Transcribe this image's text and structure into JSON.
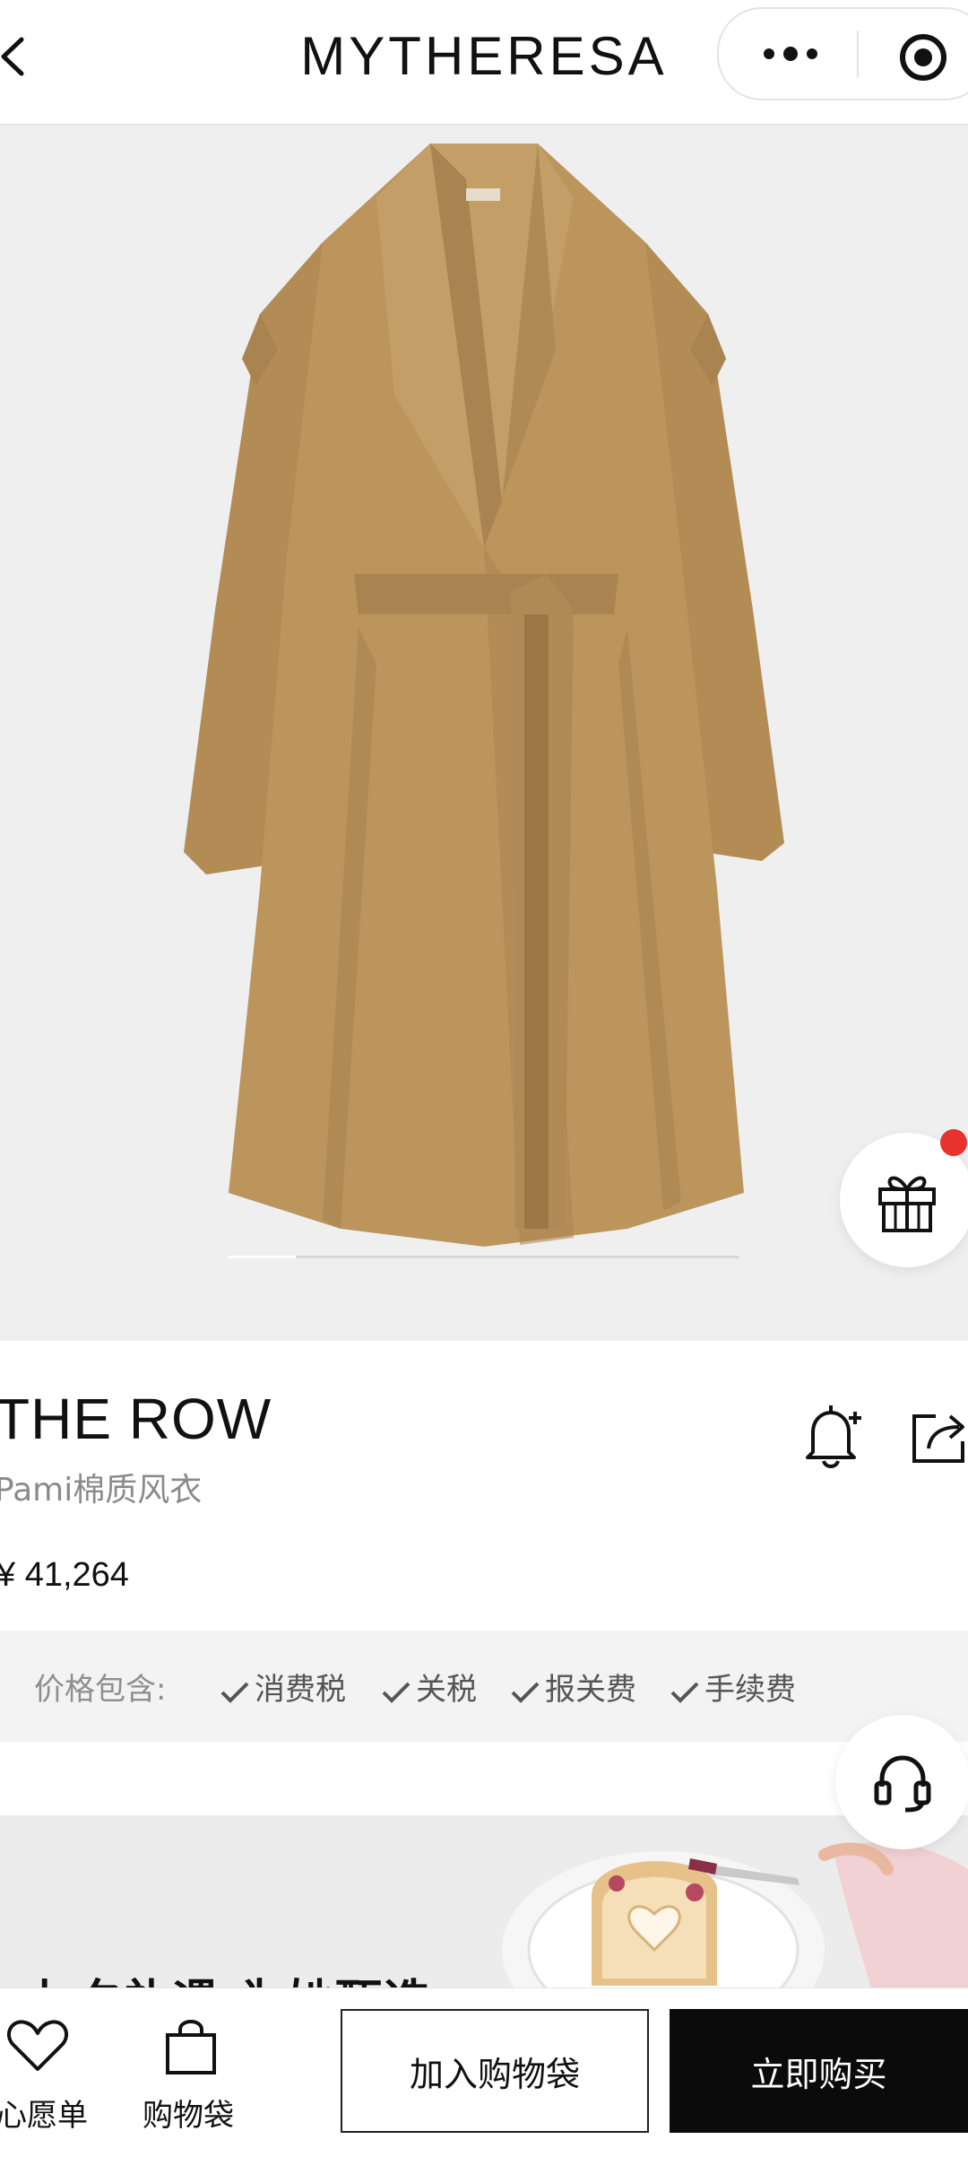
{
  "header": {
    "brand": "MYTHERESA",
    "back_icon": "chevron-left-icon",
    "more_icon": "more-dots-icon",
    "close_icon": "target-icon"
  },
  "hero": {
    "image": "camel trench coat product photo",
    "gallery_position": 1
  },
  "gift_fab": {
    "icon": "gift-icon",
    "badge_color": "#e8322e"
  },
  "product": {
    "brand": "THE ROW",
    "name": "Pami棉质风衣",
    "price": "¥ 41,264",
    "actions": {
      "notify_icon": "bell-plus-icon",
      "share_icon": "share-icon"
    }
  },
  "price_includes": {
    "label": "价格包含:",
    "items": [
      "消费税",
      "关税",
      "报关费",
      "手续费"
    ]
  },
  "support_fab": {
    "icon": "headset-icon"
  },
  "promo": {
    "text": "七夕礼遇 为她甄选"
  },
  "bottom_bar": {
    "wishlist_label": "心愿单",
    "bag_label": "购物袋",
    "add_to_bag": "加入购物袋",
    "buy_now": "立即购买"
  },
  "colors": {
    "primary": "#0b0b0b",
    "coat": "#b8925a",
    "badge": "#e8322e"
  }
}
